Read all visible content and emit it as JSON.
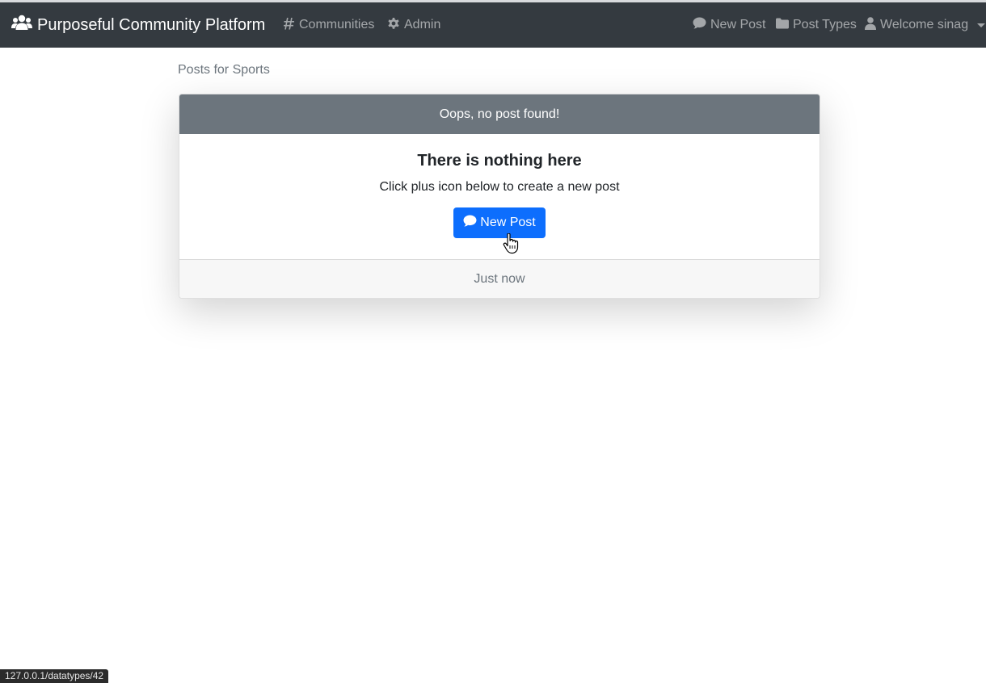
{
  "navbar": {
    "brand": "Purposeful Community Platform",
    "brand_icon": "users-icon",
    "left_links": [
      {
        "label": "Communities",
        "icon": "hashtag-icon"
      },
      {
        "label": "Admin",
        "icon": "gear-icon"
      }
    ],
    "right_links": [
      {
        "label": "New Post",
        "icon": "comment-icon"
      },
      {
        "label": "Post Types",
        "icon": "folder-icon"
      },
      {
        "label": "Welcome sinag",
        "icon": "user-icon"
      }
    ]
  },
  "page": {
    "heading": "Posts for Sports"
  },
  "card": {
    "header": "Oops, no post found!",
    "title": "There is nothing here",
    "text": "Click plus icon below to create a new post",
    "button_label": "New Post",
    "footer": "Just now"
  },
  "status_bar": {
    "url": "127.0.0.1/datatypes/42"
  },
  "colors": {
    "navbar_bg": "#343a40",
    "card_header_bg": "#6c757d",
    "primary": "#0d6efd"
  }
}
